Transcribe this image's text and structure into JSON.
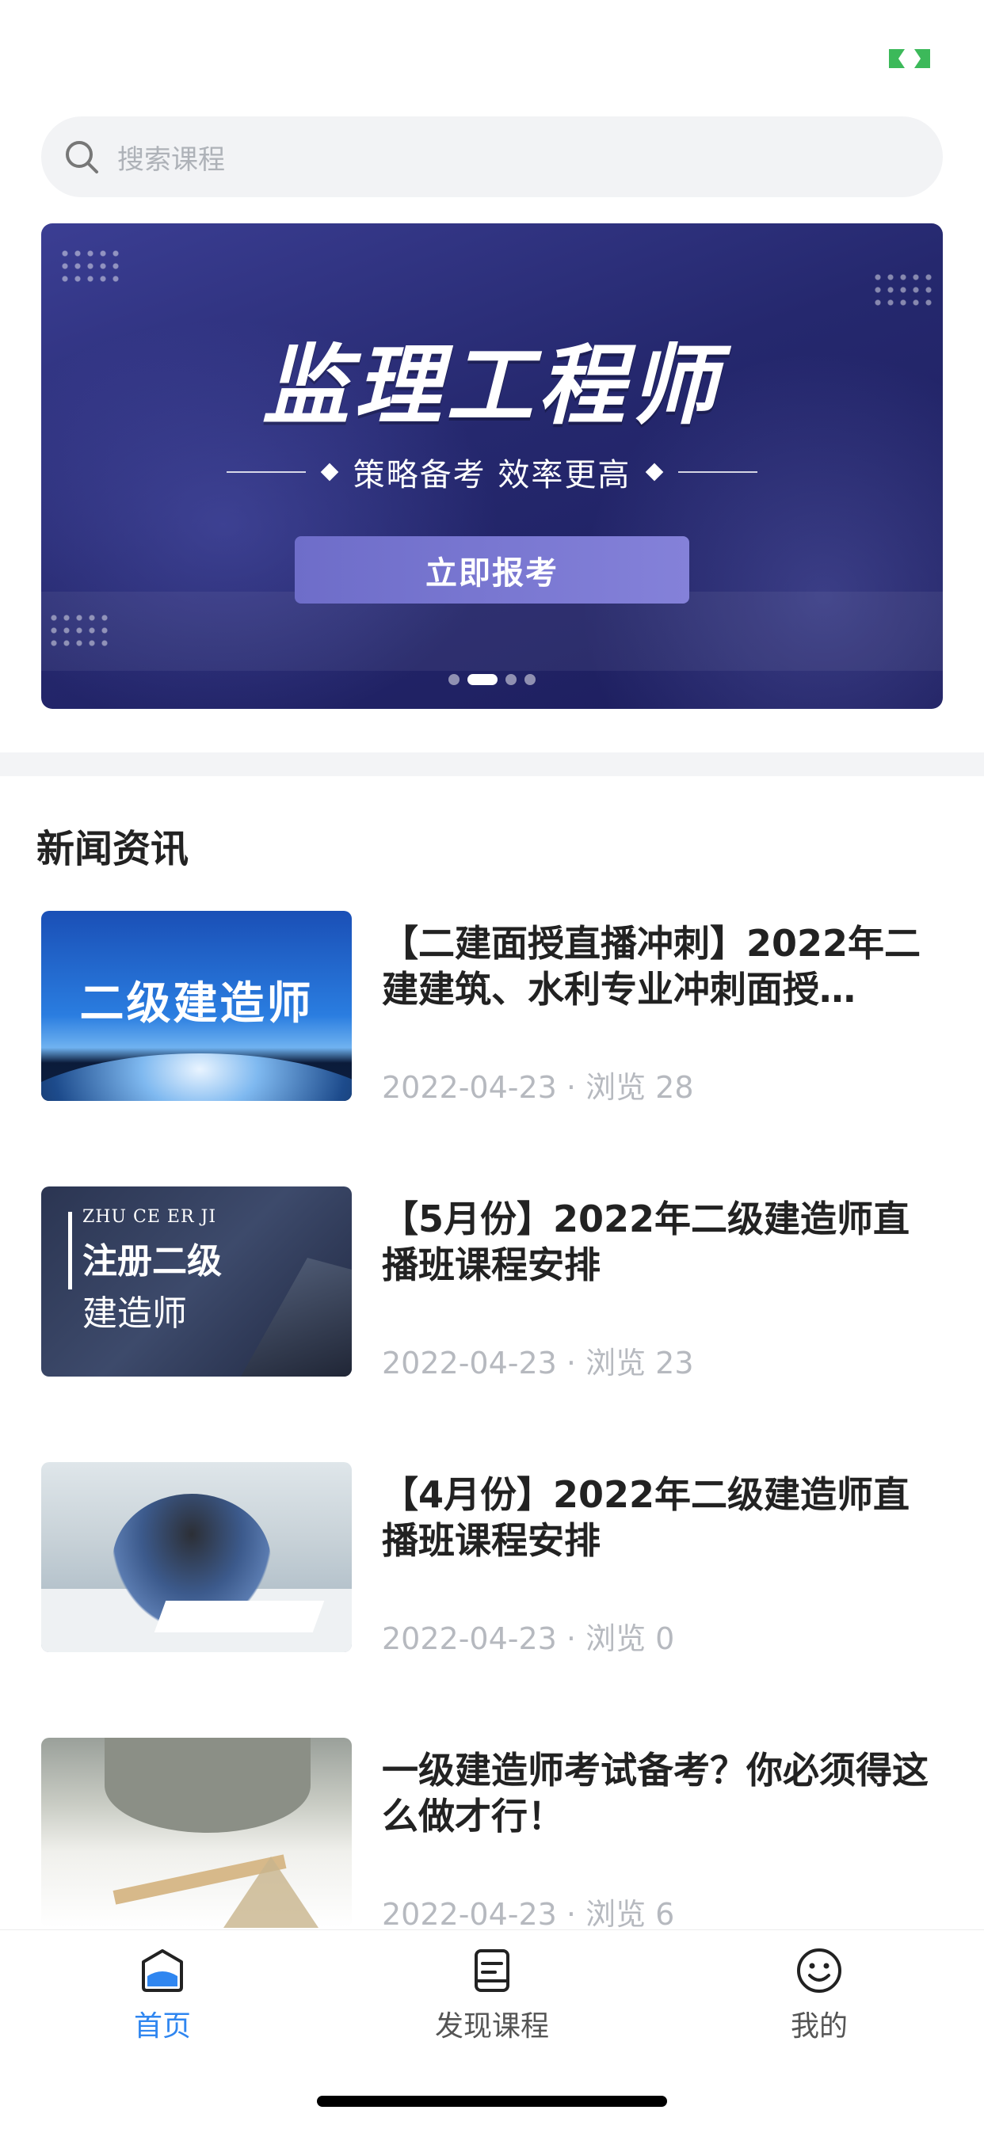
{
  "search": {
    "placeholder": "搜索课程"
  },
  "banner": {
    "title": "监理工程师",
    "subtitle": "策略备考  效率更高",
    "button_label": "立即报考",
    "page_count": 4,
    "active_index": 1
  },
  "news_section": {
    "title": "新闻资讯"
  },
  "news": [
    {
      "title": "【二建面授直播冲刺】2022年二建建筑、水利专业冲刺面授…",
      "meta": "2022-04-23 · 浏览 28",
      "thumb_text": "二级建造师"
    },
    {
      "title": "【5月份】2022年二级建造师直播班课程安排",
      "meta": "2022-04-23 · 浏览 23",
      "thumb_en": "ZHU CE ER JI",
      "thumb_zh1": "注册二级",
      "thumb_zh2": "建造师"
    },
    {
      "title": "【4月份】2022年二级建造师直播班课程安排",
      "meta": "2022-04-23 · 浏览 0"
    },
    {
      "title": "一级建造师考试备考？你必须得这么做才行！",
      "meta": "2022-04-23 · 浏览 6"
    }
  ],
  "tabbar": {
    "items": [
      {
        "label": "首页",
        "icon": "home-icon",
        "active": true
      },
      {
        "label": "发现课程",
        "icon": "course-icon",
        "active": false
      },
      {
        "label": "我的",
        "icon": "smiley-icon",
        "active": false
      }
    ]
  },
  "colors": {
    "accent": "#2f86f0",
    "banner_bg": "#25286e",
    "badge_green": "#3cb95a"
  }
}
